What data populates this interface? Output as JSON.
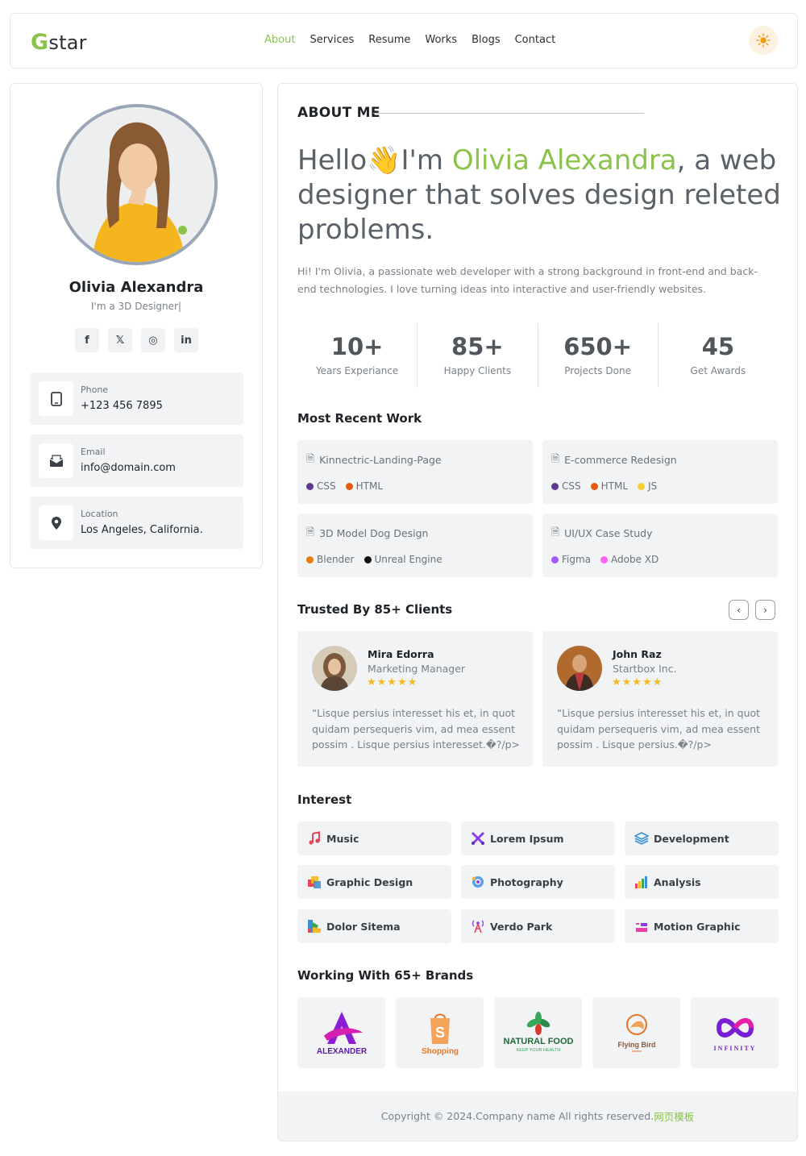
{
  "header": {
    "logo_initial": "G",
    "logo_rest": "star",
    "nav": [
      "About",
      "Services",
      "Resume",
      "Works",
      "Blogs",
      "Contact"
    ],
    "active_nav": "About",
    "theme_icon": "sun-icon"
  },
  "profile": {
    "name": "Olivia Alexandra",
    "role": "I'm a 3D Designer|",
    "socials": [
      {
        "icon": "facebook-icon",
        "glyph": "f"
      },
      {
        "icon": "x-icon",
        "glyph": "𝕏"
      },
      {
        "icon": "instagram-icon",
        "glyph": "◎"
      },
      {
        "icon": "linkedin-icon",
        "glyph": "in"
      }
    ],
    "contacts": [
      {
        "label": "Phone",
        "value": "+123 456 7895",
        "icon": "phone-icon"
      },
      {
        "label": "Email",
        "value": "info@domain.com",
        "icon": "mail-icon"
      },
      {
        "label": "Location",
        "value": "Los Angeles, California.",
        "icon": "location-icon"
      }
    ]
  },
  "about": {
    "heading": "ABOUT ME",
    "hero_pre": "Hello",
    "hero_wave": "👋",
    "hero_mid": "I'm ",
    "hero_name": "Olivia Alexandra",
    "hero_post": ", a web designer that solves design releted problems.",
    "intro": "Hi! I'm Olivia, a passionate web developer with a strong background in front-end and back-end technologies. I love turning ideas into interactive and user-friendly websites."
  },
  "stats": [
    {
      "value": "10+",
      "label": "Years Experiance"
    },
    {
      "value": "85+",
      "label": "Happy Clients"
    },
    {
      "value": "650+",
      "label": "Projects Done"
    },
    {
      "value": "45",
      "label": "Get Awards"
    }
  ],
  "recent_work": {
    "title": "Most Recent Work",
    "items": [
      {
        "title": "Kinnectric-Landing-Page",
        "tags": [
          {
            "name": "CSS",
            "color": "#5b3a8c"
          },
          {
            "name": "HTML",
            "color": "#e8580c"
          }
        ]
      },
      {
        "title": "E-commerce Redesign",
        "tags": [
          {
            "name": "CSS",
            "color": "#5b3a8c"
          },
          {
            "name": "HTML",
            "color": "#e8580c"
          },
          {
            "name": "JS",
            "color": "#f3d02b"
          }
        ]
      },
      {
        "title": "3D Model Dog Design",
        "tags": [
          {
            "name": "Blender",
            "color": "#e87d0d"
          },
          {
            "name": "Unreal Engine",
            "color": "#111111"
          }
        ]
      },
      {
        "title": "UI/UX Case Study",
        "tags": [
          {
            "name": "Figma",
            "color": "#a259ff"
          },
          {
            "name": "Adobe XD",
            "color": "#ff61f6"
          }
        ]
      }
    ]
  },
  "clients": {
    "title": "Trusted By 85+ Clients",
    "prev_icon": "chevron-left-icon",
    "next_icon": "chevron-right-icon",
    "items": [
      {
        "name": "Mira Edorra",
        "role": "Marketing Manager",
        "stars": "★★★★★",
        "text": "“Lisque persius interesset his et, in quot quidam persequeris vim, ad mea essent possim . Lisque persius interesset.�?/p>"
      },
      {
        "name": "John Raz",
        "role": "Startbox Inc.",
        "stars": "★★★★★",
        "text": "“Lisque persius interesset his et, in quot quidam persequeris vim, ad mea essent possim . Lisque persius.�?/p>"
      }
    ]
  },
  "interest": {
    "title": "Interest",
    "items": [
      {
        "label": "Music",
        "icon": "music-icon"
      },
      {
        "label": "Lorem Ipsum",
        "icon": "scissors-icon"
      },
      {
        "label": "Development",
        "icon": "layers-icon"
      },
      {
        "label": "Graphic Design",
        "icon": "palette-icon"
      },
      {
        "label": "Photography",
        "icon": "camera-icon"
      },
      {
        "label": "Analysis",
        "icon": "bar-chart-icon"
      },
      {
        "label": "Dolor Sitema",
        "icon": "color-swatch-icon"
      },
      {
        "label": "Verdo Park",
        "icon": "tower-icon"
      },
      {
        "label": "Motion Graphic",
        "icon": "motion-icon"
      }
    ]
  },
  "brands": {
    "title": "Working With 65+ Brands",
    "items": [
      {
        "name": "ALEXANDER"
      },
      {
        "name": "Shopping"
      },
      {
        "name": "NATURAL FOOD",
        "tagline": "KEEP YOUR HEALTH"
      },
      {
        "name": "Flying Bird"
      },
      {
        "name": "INFINITY"
      }
    ]
  },
  "footer": {
    "text": "Copyright © 2024.Company name All rights reserved.",
    "link": "网页模板"
  }
}
